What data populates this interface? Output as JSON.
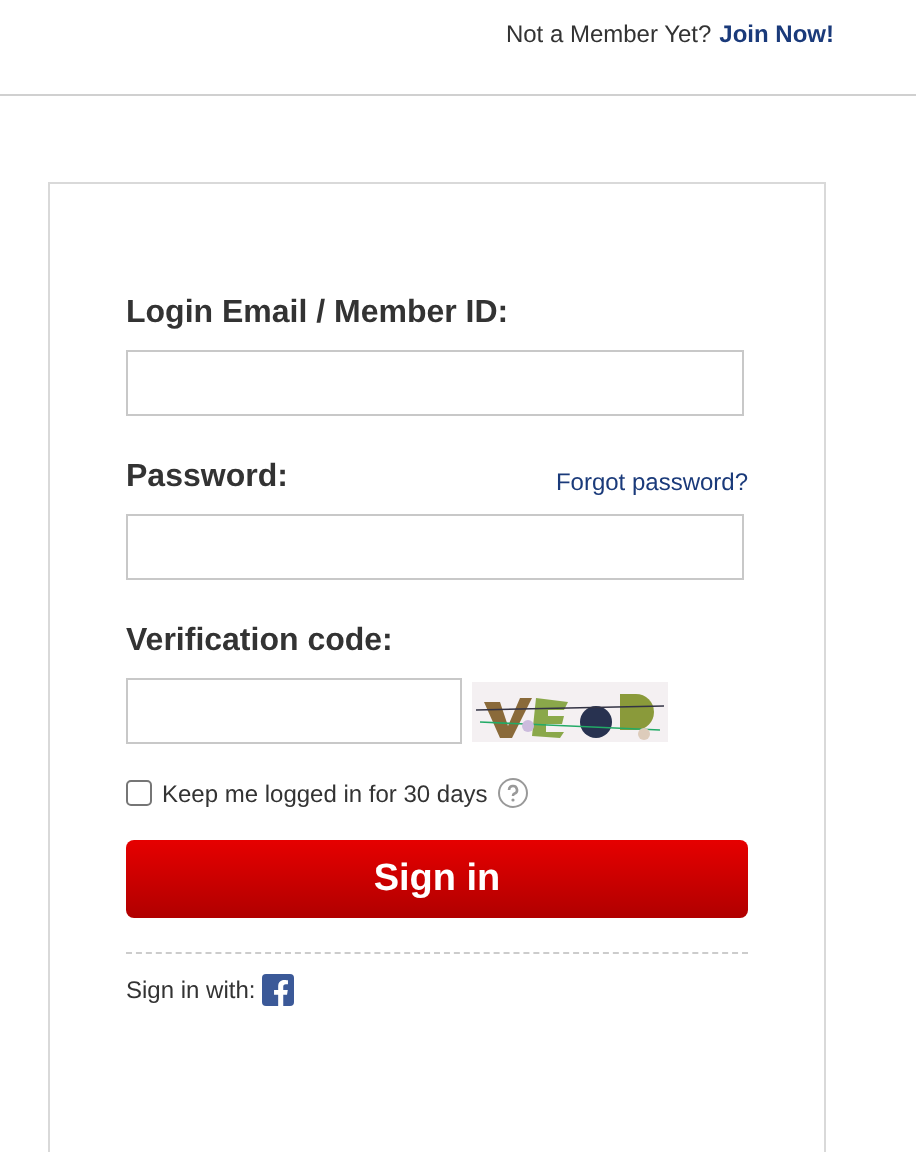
{
  "header": {
    "prompt": "Not a Member Yet?",
    "join_link": "Join Now!"
  },
  "form": {
    "email_label": "Login Email / Member ID:",
    "password_label": "Password:",
    "forgot_link": "Forgot password?",
    "verification_label": "Verification code:",
    "keep_logged_in": {
      "label": "Keep me logged in for 30 days",
      "checked": false
    },
    "sign_in_button": "Sign in",
    "sign_in_with": "Sign in with:"
  }
}
